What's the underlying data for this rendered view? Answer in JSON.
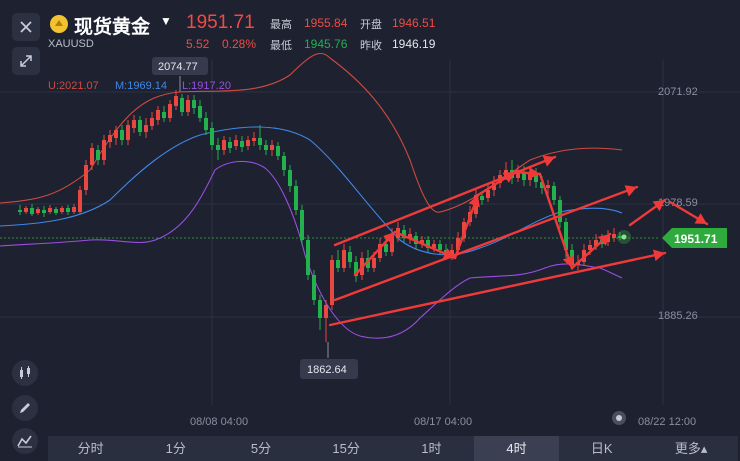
{
  "header": {
    "title": "现货黄金",
    "symbol": "XAUUSD",
    "price": "1951.71",
    "change": "5.52",
    "change_pct": "0.28%",
    "high_label": "最高",
    "high_value": "1955.84",
    "open_label": "开盘",
    "open_value": "1946.51",
    "low_label": "最低",
    "low_value": "1945.76",
    "prevclose_label": "昨收",
    "prevclose_value": "1946.19"
  },
  "indicator": {
    "upper": "U:2021.07",
    "middle": "M:1969.14",
    "lower": "L:1917.20"
  },
  "chart_data": {
    "type": "candlestick",
    "y_ticks": [
      "2071.92",
      "1978.59",
      "1885.26"
    ],
    "x_ticks": [
      "08/08 04:00",
      "08/17 04:00",
      "08/22 12:00"
    ],
    "high_marker": "2074.77",
    "low_marker": "1862.64",
    "current_price": "1951.71",
    "series_names": [
      "U",
      "M",
      "L"
    ]
  },
  "colors": {
    "up": "#e8483f",
    "down": "#22b14c",
    "upper_band": "#d04a42",
    "middle_band": "#3f88e8",
    "lower_band": "#9b4ee2",
    "arrows": "#f03a3a",
    "price_tag": "#2faa3c"
  },
  "icons": [
    "close-icon",
    "expand-icon",
    "candlestick-icon",
    "pencil-icon",
    "indicator-icon"
  ],
  "tabs": [
    {
      "label": "分时",
      "active": false
    },
    {
      "label": "1分",
      "active": false
    },
    {
      "label": "5分",
      "active": false
    },
    {
      "label": "15分",
      "active": false
    },
    {
      "label": "1时",
      "active": false
    },
    {
      "label": "4时",
      "active": true
    },
    {
      "label": "日K",
      "active": false
    },
    {
      "label": "更多▴",
      "active": false
    }
  ]
}
